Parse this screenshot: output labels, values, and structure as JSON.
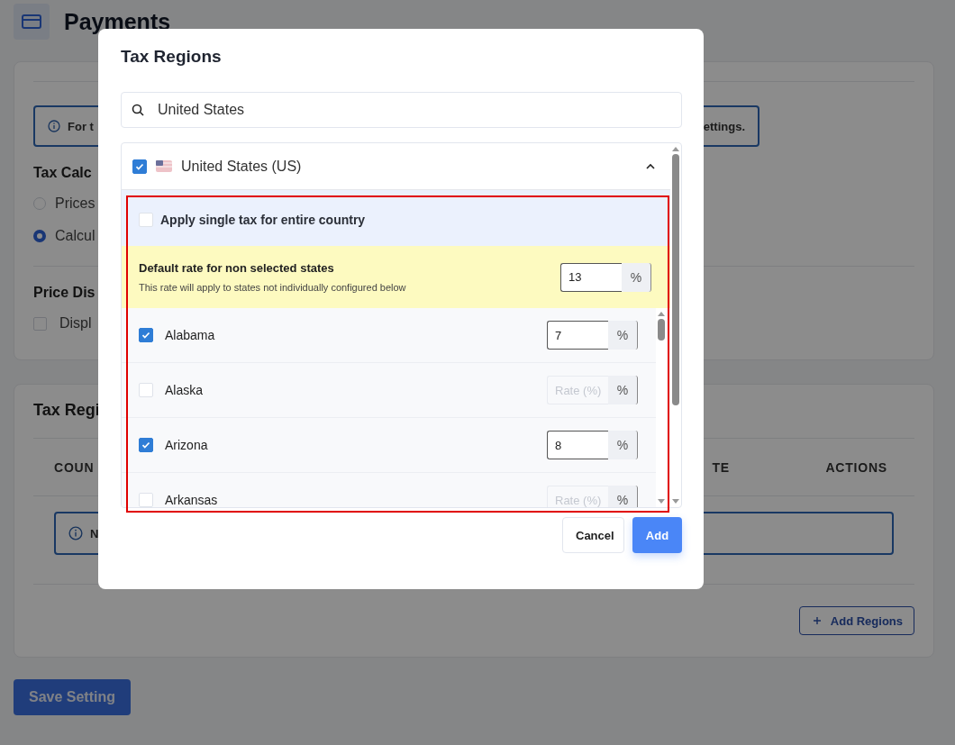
{
  "page": {
    "title": "Payments"
  },
  "settings_card": {
    "info_fragments": [
      "For t",
      "ettings."
    ],
    "tax_calc_heading": "Tax Calc",
    "radios": [
      {
        "label": "Prices",
        "selected": false
      },
      {
        "label": "Calcul",
        "selected": true
      }
    ],
    "price_display_heading": "Price Dis",
    "display_option": {
      "label": "Displ",
      "checked": false
    }
  },
  "regions_card": {
    "heading": "Tax Regi",
    "columns": [
      "COUN",
      "TE",
      "ACTIONS"
    ],
    "empty_notice": "N",
    "add_button": "Add Regions"
  },
  "save_button": "Save Setting",
  "modal": {
    "title": "Tax Regions",
    "search": {
      "value": "United States"
    },
    "country": {
      "name": "United States (US)",
      "checked": true,
      "expanded": true
    },
    "apply_single": {
      "label": "Apply single tax for entire country",
      "checked": false
    },
    "default_rate": {
      "title": "Default rate for non selected states",
      "note": "This rate will apply to states not individually configured below",
      "value": "13",
      "unit": "%"
    },
    "states": [
      {
        "name": "Alabama",
        "checked": true,
        "rate": "7",
        "unit": "%"
      },
      {
        "name": "Alaska",
        "checked": false,
        "placeholder": "Rate (%)",
        "unit": "%"
      },
      {
        "name": "Arizona",
        "checked": true,
        "rate": "8",
        "unit": "%"
      },
      {
        "name": "Arkansas",
        "checked": false,
        "placeholder": "Rate (%)",
        "unit": "%"
      }
    ],
    "buttons": [
      "Cancel",
      "Add"
    ]
  }
}
